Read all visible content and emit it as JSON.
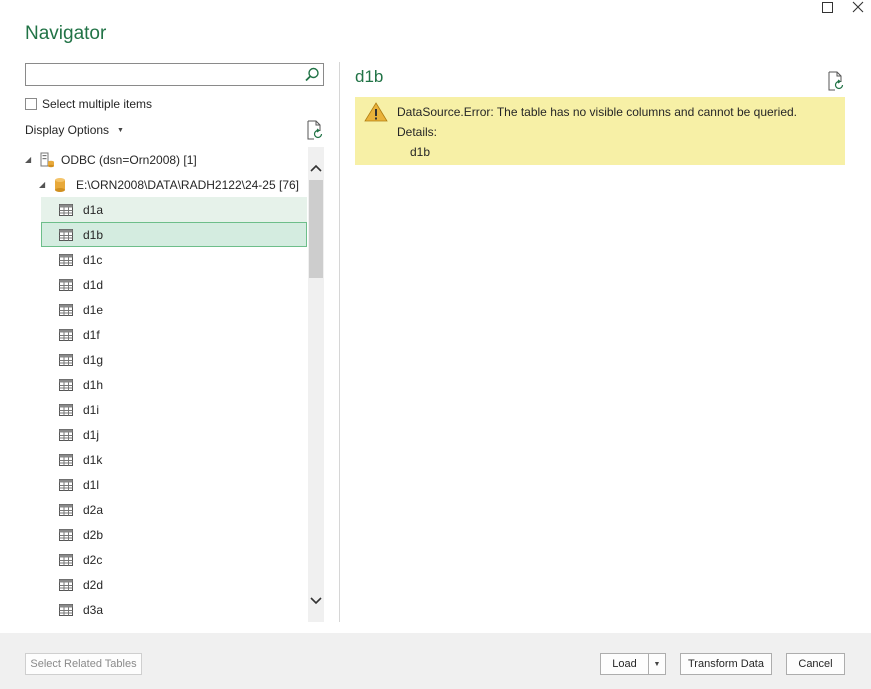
{
  "window": {
    "title": "Navigator",
    "maximize_icon": "maximize-icon",
    "close_icon": "close-icon"
  },
  "search": {
    "value": "",
    "placeholder": "",
    "icon": "search-icon"
  },
  "select_multiple": {
    "label": "Select multiple items",
    "checked": false
  },
  "display_options": {
    "label": "Display Options",
    "icon": "chevron-down-icon"
  },
  "tree": {
    "source": {
      "label": "ODBC (dsn=Orn2008) [1]",
      "icon": "odbc-source-icon",
      "expanded": true
    },
    "database": {
      "label": "E:\\ORN2008\\DATA\\RADH2122\\24-25 [76]",
      "icon": "database-icon",
      "expanded": true
    },
    "tables": [
      {
        "label": "d1a"
      },
      {
        "label": "d1b"
      },
      {
        "label": "d1c"
      },
      {
        "label": "d1d"
      },
      {
        "label": "d1e"
      },
      {
        "label": "d1f"
      },
      {
        "label": "d1g"
      },
      {
        "label": "d1h"
      },
      {
        "label": "d1i"
      },
      {
        "label": "d1j"
      },
      {
        "label": "d1k"
      },
      {
        "label": "d1l"
      },
      {
        "label": "d2a"
      },
      {
        "label": "d2b"
      },
      {
        "label": "d2c"
      },
      {
        "label": "d2d"
      },
      {
        "label": "d3a"
      }
    ],
    "selected": "d1b",
    "hovered": "d1a"
  },
  "preview": {
    "title": "d1b",
    "error": {
      "message": "DataSource.Error: The table has no visible columns and cannot be queried.",
      "details_label": "Details:",
      "details_value": "d1b",
      "icon": "warning-icon"
    }
  },
  "footer": {
    "select_related": "Select Related Tables",
    "load": "Load",
    "transform": "Transform Data",
    "cancel": "Cancel"
  },
  "colors": {
    "accent": "#217346",
    "selection_bg": "#d4ece0",
    "selection_border": "#6dbe8a",
    "error_bg": "#f7f0a6",
    "footer_bg": "#f0f0f0"
  }
}
